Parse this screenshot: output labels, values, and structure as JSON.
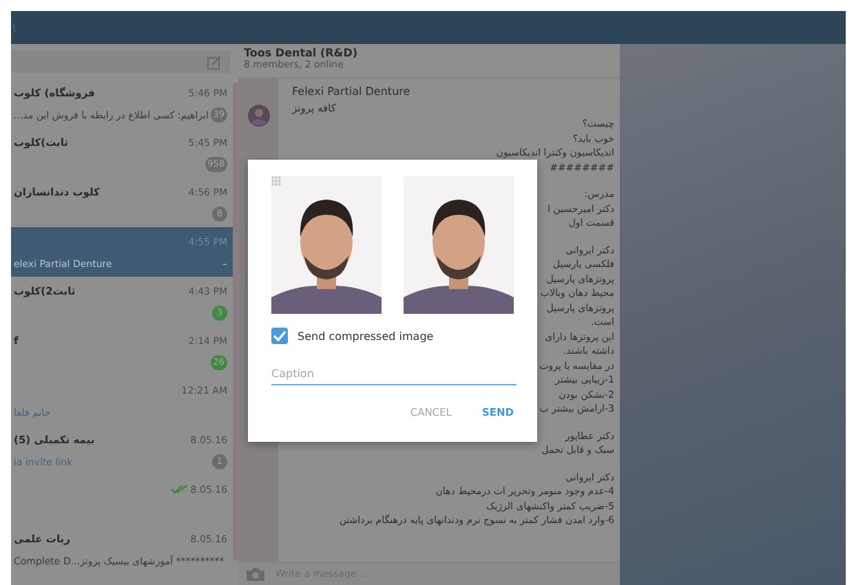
{
  "top_bar": {
    "text": "t"
  },
  "chat_list": {
    "chats": [
      {
        "name": "فروشگاه) کلوب",
        "time": "5:46 PM",
        "preview": {
          "text": "ابراهیم: کسی اطلاع در رابطه با فروش این مد...",
          "color": "#3a3a3a"
        },
        "badge": {
          "text": "39",
          "color": "#6c6c6c"
        },
        "selected": false
      },
      {
        "name": "ثابت)کلوب",
        "time": "5:45 PM",
        "badge": {
          "text": "958",
          "color": "#6c6c6c"
        },
        "selected": false
      },
      {
        "name": "کلوب دندانسازان",
        "time": "4:56 PM",
        "badge": {
          "text": "8",
          "color": "#6c6c6c"
        },
        "selected": false
      },
      {
        "time": "4:55 PM",
        "preview": {
          "text": "elexi Partial Denture",
          "color": "#b6c4d2"
        },
        "tail": "–",
        "selected": true
      },
      {
        "name": "ثابت2)کلوب",
        "time": "4:43 PM",
        "badge": {
          "text": "3",
          "color": "#3e8a3e"
        },
        "selected": false
      },
      {
        "name": "f",
        "time": "2:14 PM",
        "badge": {
          "text": "26",
          "color": "#3e8a3e"
        },
        "selected": false
      },
      {
        "time": "12:21 AM",
        "preview": {
          "text": "خانم فلفا",
          "color": "#44627f"
        },
        "selected": false
      },
      {
        "name": "(بیمه تکمیلی (5",
        "time": "8.05.16",
        "preview": {
          "text": "ia invite link",
          "color": "#44627f"
        },
        "badge": {
          "text": "1",
          "color": "#6c6c6c"
        },
        "selected": false
      },
      {
        "time": "8.05.16",
        "read": true,
        "selected": false
      },
      {
        "name": "ربات علمی",
        "time": "8.05.16",
        "preview": {
          "text": "Complete D...آموزشهای بیسیک پروتز **********",
          "color": "#3a3a3a"
        },
        "selected": false
      }
    ]
  },
  "chat": {
    "title": "Toos Dental (R&D)",
    "subtitle": "8 members, 2 online",
    "message": {
      "sender": "Felexi Partial Denture",
      "first_line": "کافه پروتز",
      "paragraphs": [
        [
          "چیست؟",
          "خوب باید؟",
          "اندیکاسیون وکنترا اندیکاسیون",
          "########"
        ],
        [
          "مدرس:",
          "دکتر امیرحسین ا",
          "قسمت اول"
        ],
        [
          "دکتر ایروانی",
          "فلکسی پارسیل",
          "پروتزهای پارسیل",
          "محیط دهان وبالاب",
          "پروتزهای پارسیل",
          "است.",
          "این پروتزها دارای",
          "داشته باشند.",
          "در مقایسه با پروت",
          "1-زیبایی بیشتر",
          "2-نشکن بودن",
          "3-ارامش بیشتر ب"
        ],
        [
          "دکتر عطاپور",
          "سبک و قابل تحمل"
        ],
        [
          "دکتر ایروانی",
          "4-عدم وجود منومر وتحریر ات درمحیط دهان",
          "5-ضریب کمتر واکنشهای الرژیک",
          "6-وارد امدن فشار کمتر به نسوج نرم ودندانهای پایه درهنگام برداشتن"
        ]
      ]
    },
    "composer": {
      "placeholder": "Write a message..."
    }
  },
  "dialog": {
    "compress": {
      "label": "Send compressed image",
      "checked": true
    },
    "caption": {
      "placeholder": "Caption"
    },
    "cancel_button": {
      "label": "CANCEL"
    },
    "send_button": {
      "label": "SEND"
    }
  }
}
